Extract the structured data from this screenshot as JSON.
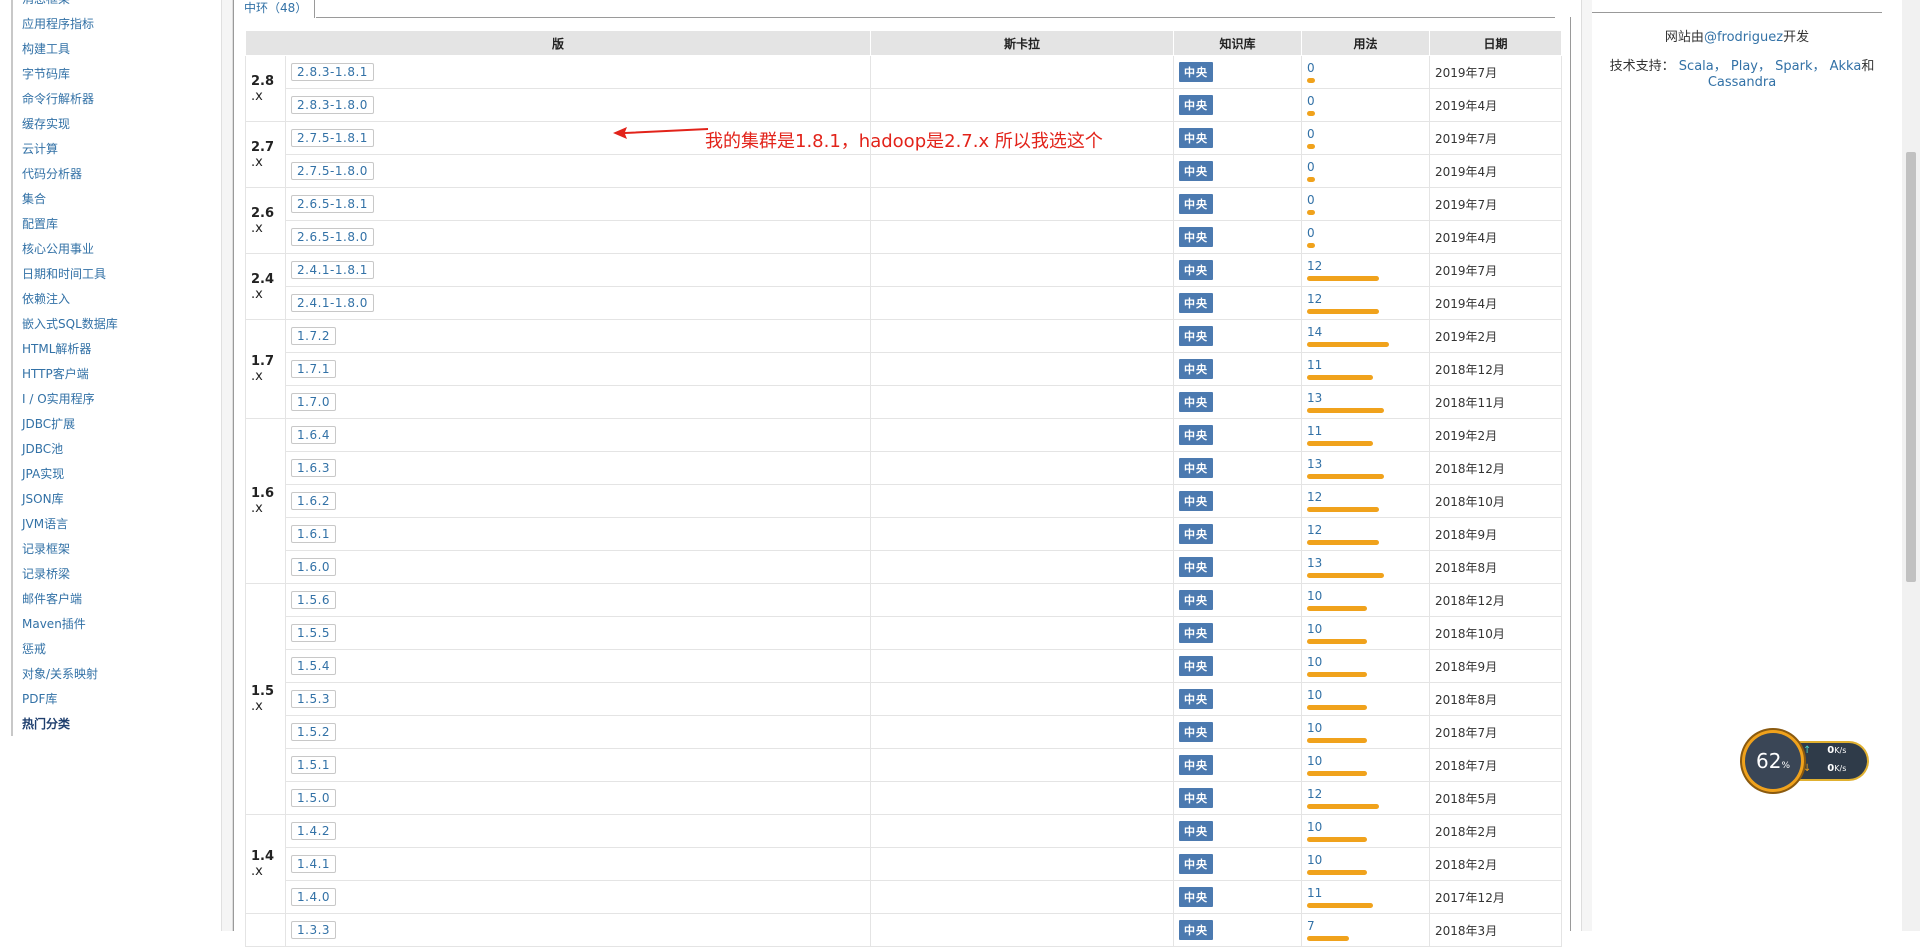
{
  "sidebar": {
    "items": [
      "消息框架",
      "应用程序指标",
      "构建工具",
      "字节码库",
      "命令行解析器",
      "缓存实现",
      "云计算",
      "代码分析器",
      "集合",
      "配置库",
      "核心公用事业",
      "日期和时间工具",
      "依赖注入",
      "嵌入式SQL数据库",
      "HTML解析器",
      "HTTP客户端",
      "I / O实用程序",
      "JDBC扩展",
      "JDBC池",
      "JPA实现",
      "JSON库",
      "JVM语言",
      "记录框架",
      "记录桥梁",
      "邮件客户端",
      "Maven插件",
      "惩戒",
      "对象/关系映射",
      "PDF库"
    ],
    "hot": "热门分类"
  },
  "tab": {
    "label": "中环（48）"
  },
  "table": {
    "headers": [
      "版",
      "斯卡拉",
      "知识库",
      "用法",
      "日期"
    ],
    "repo_label": "中央",
    "groups": [
      {
        "major": "2.8",
        "suffix": ".x",
        "rows": [
          {
            "version": "2.8.3-1.8.1",
            "usage": "0",
            "usage_fraction": 0.08,
            "date": "2019年7月"
          },
          {
            "version": "2.8.3-1.8.0",
            "usage": "0",
            "usage_fraction": 0.08,
            "date": "2019年4月"
          }
        ]
      },
      {
        "major": "2.7",
        "suffix": ".x",
        "rows": [
          {
            "version": "2.7.5-1.8.1",
            "usage": "0",
            "usage_fraction": 0.08,
            "date": "2019年7月"
          },
          {
            "version": "2.7.5-1.8.0",
            "usage": "0",
            "usage_fraction": 0.08,
            "date": "2019年4月"
          }
        ]
      },
      {
        "major": "2.6",
        "suffix": ".x",
        "rows": [
          {
            "version": "2.6.5-1.8.1",
            "usage": "0",
            "usage_fraction": 0.08,
            "date": "2019年7月"
          },
          {
            "version": "2.6.5-1.8.0",
            "usage": "0",
            "usage_fraction": 0.08,
            "date": "2019年4月"
          }
        ]
      },
      {
        "major": "2.4",
        "suffix": ".x",
        "rows": [
          {
            "version": "2.4.1-1.8.1",
            "usage": "12",
            "usage_fraction": 0.72,
            "date": "2019年7月"
          },
          {
            "version": "2.4.1-1.8.0",
            "usage": "12",
            "usage_fraction": 0.72,
            "date": "2019年4月"
          }
        ]
      },
      {
        "major": "1.7",
        "suffix": ".x",
        "rows": [
          {
            "version": "1.7.2",
            "usage": "14",
            "usage_fraction": 0.82,
            "date": "2019年2月"
          },
          {
            "version": "1.7.1",
            "usage": "11",
            "usage_fraction": 0.66,
            "date": "2018年12月"
          },
          {
            "version": "1.7.0",
            "usage": "13",
            "usage_fraction": 0.77,
            "date": "2018年11月"
          }
        ]
      },
      {
        "major": "1.6",
        "suffix": ".x",
        "rows": [
          {
            "version": "1.6.4",
            "usage": "11",
            "usage_fraction": 0.66,
            "date": "2019年2月"
          },
          {
            "version": "1.6.3",
            "usage": "13",
            "usage_fraction": 0.77,
            "date": "2018年12月"
          },
          {
            "version": "1.6.2",
            "usage": "12",
            "usage_fraction": 0.72,
            "date": "2018年10月"
          },
          {
            "version": "1.6.1",
            "usage": "12",
            "usage_fraction": 0.72,
            "date": "2018年9月"
          },
          {
            "version": "1.6.0",
            "usage": "13",
            "usage_fraction": 0.77,
            "date": "2018年8月"
          }
        ]
      },
      {
        "major": "1.5",
        "suffix": ".x",
        "rows": [
          {
            "version": "1.5.6",
            "usage": "10",
            "usage_fraction": 0.6,
            "date": "2018年12月"
          },
          {
            "version": "1.5.5",
            "usage": "10",
            "usage_fraction": 0.6,
            "date": "2018年10月"
          },
          {
            "version": "1.5.4",
            "usage": "10",
            "usage_fraction": 0.6,
            "date": "2018年9月"
          },
          {
            "version": "1.5.3",
            "usage": "10",
            "usage_fraction": 0.6,
            "date": "2018年8月"
          },
          {
            "version": "1.5.2",
            "usage": "10",
            "usage_fraction": 0.6,
            "date": "2018年7月"
          },
          {
            "version": "1.5.1",
            "usage": "10",
            "usage_fraction": 0.6,
            "date": "2018年7月"
          },
          {
            "version": "1.5.0",
            "usage": "12",
            "usage_fraction": 0.72,
            "date": "2018年5月"
          }
        ]
      },
      {
        "major": "1.4",
        "suffix": ".x",
        "rows": [
          {
            "version": "1.4.2",
            "usage": "10",
            "usage_fraction": 0.6,
            "date": "2018年2月"
          },
          {
            "version": "1.4.1",
            "usage": "10",
            "usage_fraction": 0.6,
            "date": "2018年2月"
          },
          {
            "version": "1.4.0",
            "usage": "11",
            "usage_fraction": 0.66,
            "date": "2017年12月"
          }
        ]
      },
      {
        "major": "",
        "suffix": "",
        "rows": [
          {
            "version": "1.3.3",
            "usage": "7",
            "usage_fraction": 0.42,
            "date": "2018年3月"
          }
        ]
      }
    ]
  },
  "annotation": {
    "text": "我的集群是1.8.1，hadoop是2.7.x 所以我选这个",
    "color": "#e2231a"
  },
  "right": {
    "site_prefix": "网站由",
    "site_author": "@frodriguez",
    "site_suffix": "开发",
    "tech_prefix": "技术支持：",
    "tech_links": [
      "Scala，",
      "Play，",
      "Spark，",
      "Akka"
    ],
    "tech_and": "和",
    "tech_last": "Cassandra"
  },
  "widget": {
    "percent": "62",
    "percent_unit": "%",
    "up": "0",
    "down": "0",
    "unit": "K/s"
  },
  "colors": {
    "link": "#3271a6",
    "bar": "#f0a21c",
    "repo_badge": "#4c7ab0",
    "header_bg": "#e4e4e4"
  }
}
